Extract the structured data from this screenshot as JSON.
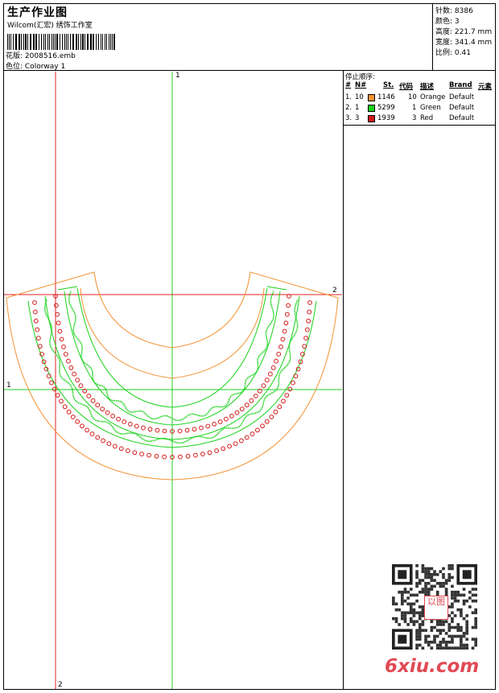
{
  "header": {
    "title": "生产作业图",
    "studio": "Wilcom(汇宏) 绣饰工作室",
    "design_label": "花版:",
    "design_value": "2008516.emb",
    "colorway_label": "色位:",
    "colorway_value": "Colorway 1"
  },
  "specs": [
    {
      "label": "针数:",
      "value": "8386"
    },
    {
      "label": "颜色:",
      "value": "3"
    },
    {
      "label": "高度:",
      "value": "221.7 mm"
    },
    {
      "label": "宽度:",
      "value": "341.4 mm"
    },
    {
      "label": "比例:",
      "value": "0.41"
    }
  ],
  "stop_sequence": {
    "title": "停止顺序:",
    "columns": [
      "#",
      "N#",
      "St.",
      "代码",
      "描述",
      "Brand",
      "元素"
    ],
    "rows": [
      {
        "idx": "1.",
        "n": "10",
        "color": "#f39232",
        "stitches": "1146",
        "code": "10",
        "desc": "Orange",
        "brand": "Default"
      },
      {
        "idx": "2.",
        "n": "1",
        "color": "#19d219",
        "stitches": "5299",
        "code": "1",
        "desc": "Green",
        "brand": "Default"
      },
      {
        "idx": "3.",
        "n": "3",
        "color": "#d21919",
        "stitches": "1939",
        "code": "3",
        "desc": "Red",
        "brand": "Default"
      }
    ]
  },
  "guides": {
    "vertical_green_label": "1",
    "vertical_red_label": "2",
    "horizontal_red_label": "2",
    "horizontal_green_label": "1"
  },
  "colors": {
    "orange": "#f39232",
    "green": "#19d219",
    "red": "#d21919",
    "guide_green": "#22cc22",
    "guide_red": "#e02020"
  },
  "watermark": "6xiu.com",
  "qr_seal": "以图"
}
